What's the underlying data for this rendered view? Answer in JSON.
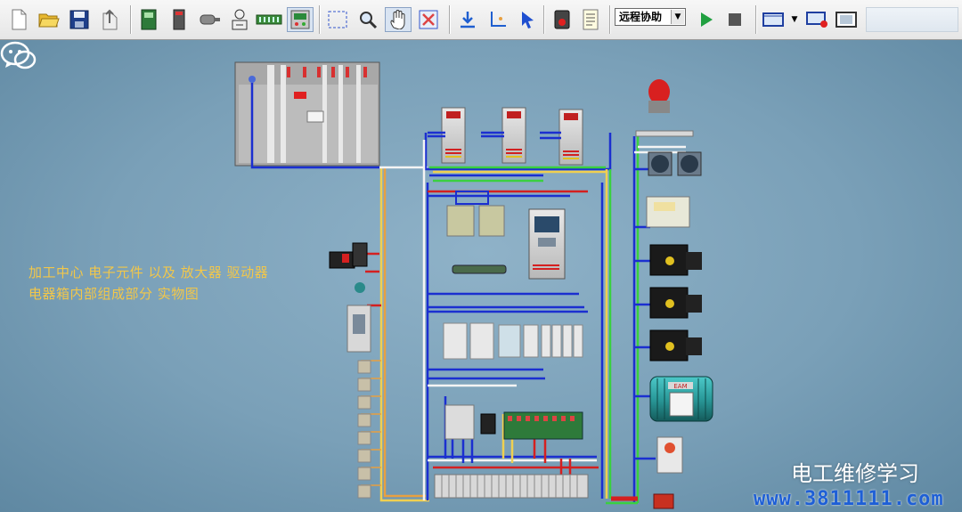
{
  "toolbar": {
    "remote_assist": "远程协助",
    "buttons": [
      "new-file",
      "open-folder",
      "save",
      "export",
      "plc-module",
      "servo-drive",
      "motor",
      "transformer",
      "terminal-block",
      "panel",
      "select-rect",
      "zoom",
      "pan",
      "fit",
      "download",
      "axis",
      "pointer",
      "record",
      "list",
      "run",
      "stop",
      "film",
      "film-dropdown",
      "film-record",
      "film-strip"
    ]
  },
  "canvas": {
    "caption_line1": "加工中心 电子元件 以及 放大器 驱动器",
    "caption_line2": "电器箱内部组成部分 实物图",
    "motor_label": "EAM",
    "colors": {
      "background": "#7aa0b8",
      "caption": "#f2c74a",
      "wire_blue": "#1b2fd0",
      "wire_yellow": "#f0d050",
      "wire_green": "#3ad040",
      "wire_red": "#d42020",
      "wire_white": "#f4f4f4",
      "wire_orange": "#e8a040"
    }
  },
  "watermark": {
    "name": "电工维修学习",
    "url": "www.3811111.com",
    "icon": "wechat-icon"
  }
}
